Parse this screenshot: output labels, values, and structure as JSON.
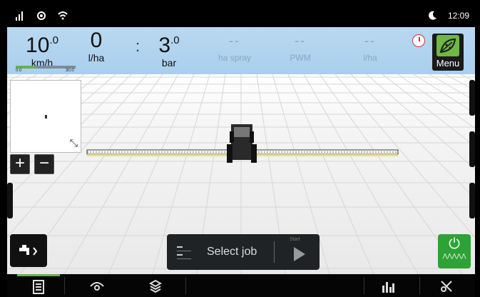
{
  "status": {
    "time": "12:09",
    "icons": [
      "signal-icon",
      "location-icon",
      "wifi-icon",
      "night-mode-icon"
    ]
  },
  "metrics": {
    "speed": {
      "value": "10",
      "decimal": ".0",
      "unit": "km/h",
      "scale_min": "0.0",
      "scale_max": "30.0",
      "fill_fraction": 0.33
    },
    "rate": {
      "value": "0",
      "unit": "l/ha"
    },
    "pressure": {
      "value": "3",
      "decimal": ".0",
      "unit": "bar"
    },
    "ha_spray": {
      "value": "--",
      "unit": "ha spray"
    },
    "pwm": {
      "value": "--",
      "unit": "PWM"
    },
    "lha2": {
      "value": "--",
      "unit": "l/ha"
    }
  },
  "menu": {
    "label": "Menu"
  },
  "minimap": {
    "zoom_in": "+",
    "zoom_out": "−"
  },
  "job": {
    "label": "Select job",
    "start_label": "Start"
  },
  "colors": {
    "accent_green": "#6ab04c",
    "power_green": "#2ea236",
    "infobar_blue": "#b9d8f0"
  },
  "bottom_nav": [
    "job-sheet-icon",
    "view-icon",
    "layers-icon",
    "statistics-icon",
    "settings-icon"
  ]
}
